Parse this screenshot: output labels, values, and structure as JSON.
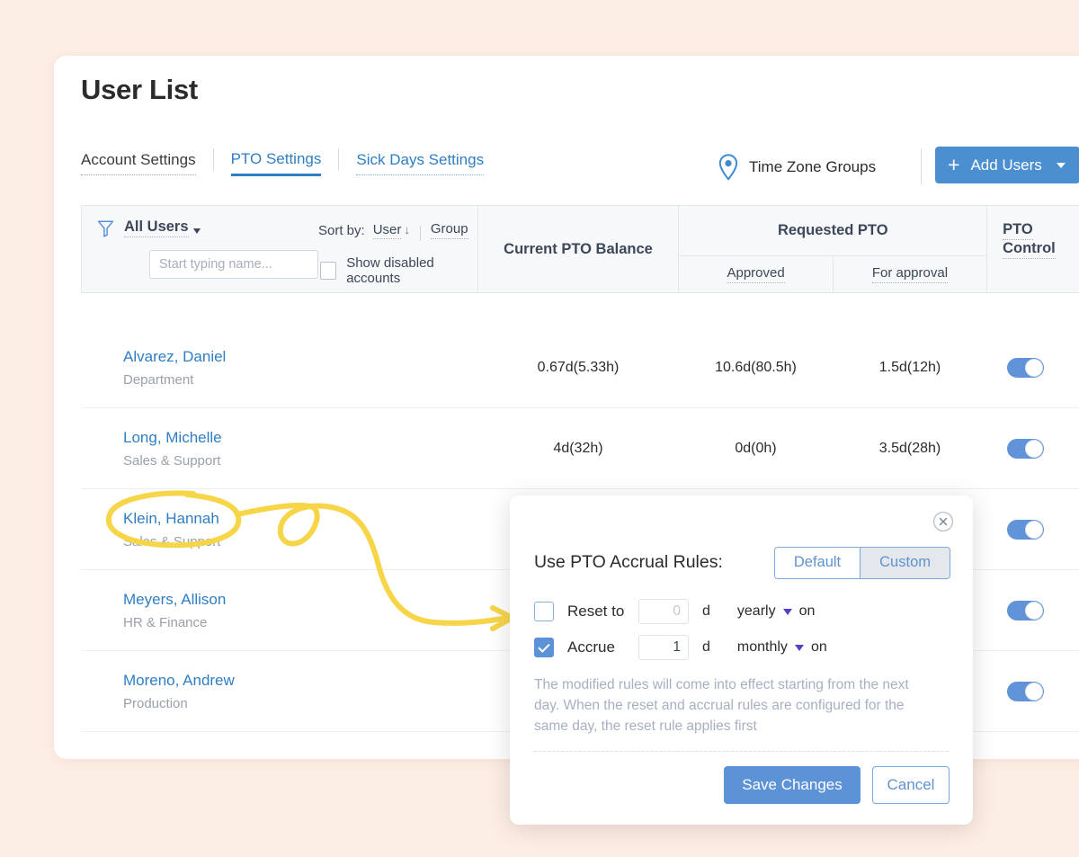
{
  "page": {
    "title": "User List",
    "background_color": "#fdeee4",
    "accent_color": "#4b8fd1",
    "link_color": "#2f7ec4"
  },
  "tabs": [
    {
      "label": "Account Settings",
      "state": "inactive-dark"
    },
    {
      "label": "PTO Settings",
      "state": "active"
    },
    {
      "label": "Sick Days Settings",
      "state": "link-dotted"
    }
  ],
  "header": {
    "time_zone_groups": "Time Zone Groups",
    "add_users": "Add Users"
  },
  "filter": {
    "all_users": "All Users",
    "search_placeholder": "Start typing name...",
    "search_value": "",
    "sort_by_label": "Sort by:",
    "sort_user": "User",
    "sort_arrow": "↓",
    "sort_group": "Group",
    "show_disabled": "Show disabled accounts",
    "show_disabled_checked": false
  },
  "columns": {
    "balance": "Current PTO Balance",
    "requested": "Requested PTO",
    "approved": "Approved",
    "for_approval": "For approval",
    "control_line1": "PTO",
    "control_line2": "Control"
  },
  "rows": [
    {
      "name": "Alvarez, Daniel",
      "dept": "Department",
      "balance": "0.67d(5.33h)",
      "approved": "10.6d(80.5h)",
      "for_approval": "1.5d(12h)",
      "toggle_on": true
    },
    {
      "name": "Long, Michelle",
      "dept": "Sales & Support",
      "balance": "4d(32h)",
      "approved": "0d(0h)",
      "for_approval": "3.5d(28h)",
      "toggle_on": true
    },
    {
      "name": "Klein, Hannah",
      "dept": "Sales & Support",
      "balance": "",
      "approved": "",
      "for_approval": "",
      "toggle_on": true
    },
    {
      "name": "Meyers, Allison",
      "dept": "HR & Finance",
      "balance": "",
      "approved": "",
      "for_approval": "",
      "toggle_on": true
    },
    {
      "name": "Moreno, Andrew",
      "dept": "Production",
      "balance": "",
      "approved": "",
      "for_approval": "",
      "toggle_on": true
    }
  ],
  "modal": {
    "title": "Use PTO Accrual Rules:",
    "segment_default": "Default",
    "segment_custom": "Custom",
    "segment_selected": "Custom",
    "reset_label": "Reset to",
    "reset_checked": false,
    "reset_value": "",
    "reset_placeholder": "0",
    "reset_unit": "d",
    "reset_period": "yearly",
    "reset_on": "on",
    "accrue_label": "Accrue",
    "accrue_checked": true,
    "accrue_value": "1",
    "accrue_unit": "d",
    "accrue_period": "monthly",
    "accrue_on": "on",
    "note": "The modified rules will come into effect starting from the next day. When the reset and accrual rules are configured for the same day, the reset rule applies first",
    "save_label": "Save Changes",
    "cancel_label": "Cancel"
  },
  "annotation": {
    "color": "#f7d548",
    "circled_item": "Klein, Hannah",
    "points_to": "Reset to checkbox"
  }
}
